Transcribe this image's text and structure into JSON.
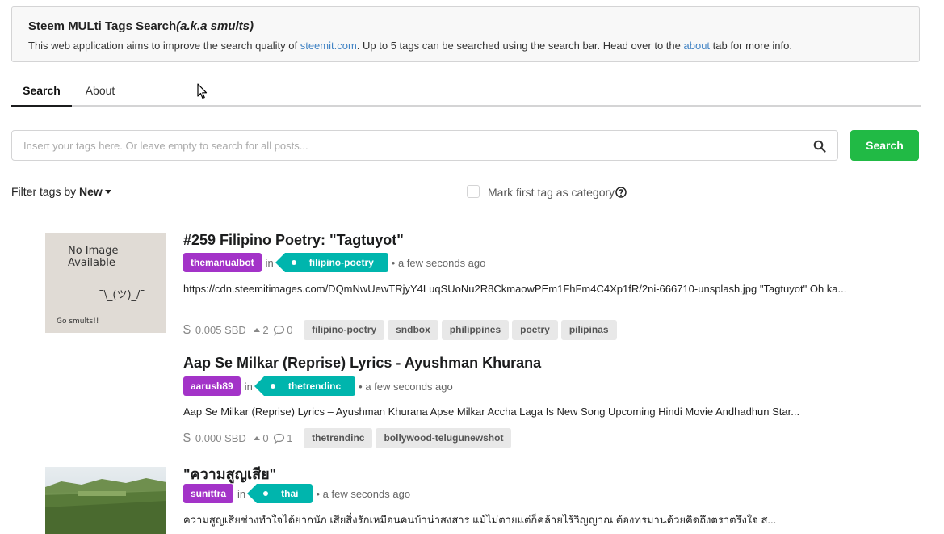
{
  "banner": {
    "title": "Steem MULti Tags Search",
    "title_aka": "(a.k.a smults)",
    "desc_1": "This web application aims to improve the search quality of ",
    "link_1": "steemit.com",
    "desc_2": ". Up to 5 tags can be searched using the search bar. Head over to the ",
    "link_2": "about",
    "desc_3": " tab for more info."
  },
  "tabs": [
    {
      "label": "Search"
    },
    {
      "label": "About"
    }
  ],
  "search": {
    "placeholder": "Insert your tags here. Or leave empty to search for all posts...",
    "button_label": "Search"
  },
  "filter": {
    "prefix": "Filter tags by ",
    "value": "New",
    "category_label": "Mark first tag as category"
  },
  "posts": [
    {
      "title": "#259 Filipino Poetry: \"Tagtuyot\"",
      "author": "themanualbot",
      "in": "in",
      "category": "filipino-poetry",
      "time": "• a few seconds ago",
      "excerpt": "https://cdn.steemitimages.com/DQmNwUewTRjyY4LuqSUoNu2R8CkmaowPEm1FhFm4C4Xp1fR/2ni-666710-unsplash.jpg \"Tagtuyot\" Oh ka...",
      "payout": "0.005 SBD",
      "votes": "2",
      "comments": "0",
      "tags": [
        "filipino-poetry",
        "sndbox",
        "philippines",
        "poetry",
        "pilipinas"
      ],
      "thumb": {
        "line1": "No Image",
        "line2": "Available",
        "face": "¯\\_(ツ)_/¯",
        "footer": "Go smults!!"
      }
    },
    {
      "title": "Aap Se Milkar (Reprise) Lyrics - Ayushman Khurana",
      "author": "aarush89",
      "in": "in",
      "category": "thetrendinc",
      "time": "• a few seconds ago",
      "excerpt": "Aap Se Milkar (Reprise) Lyrics – Ayushman Khurana Apse Milkar Accha Laga Is New Song Upcoming Hindi Movie Andhadhun Star...",
      "payout": "0.000 SBD",
      "votes": "0",
      "comments": "1",
      "tags": [
        "thetrendinc",
        "bollywood-telugunewshot"
      ]
    },
    {
      "title": "\"ความสูญเสีย\"",
      "author": "sunittra",
      "in": "in",
      "category": "thai",
      "time": "• a few seconds ago",
      "excerpt": "ความสูญเสียช่างทำใจได้ยากนัก เสียสิ่งรักเหมือนคนบ้าน่าสงสาร แม้ไม่ตายแต่ก็คล้ายไร้วิญญาณ ต้องทรมานด้วยคิดถึงตราตรึงใจ ส..."
    }
  ],
  "colors": {
    "author": "#a333c8",
    "category": "#00b5ad",
    "search_button": "#21ba45",
    "link": "#4183c4"
  },
  "icons": [
    "search-icon",
    "help-icon",
    "dollar-icon",
    "upvote-icon",
    "comment-icon",
    "mouse-cursor-icon",
    "caret-down-icon"
  ]
}
